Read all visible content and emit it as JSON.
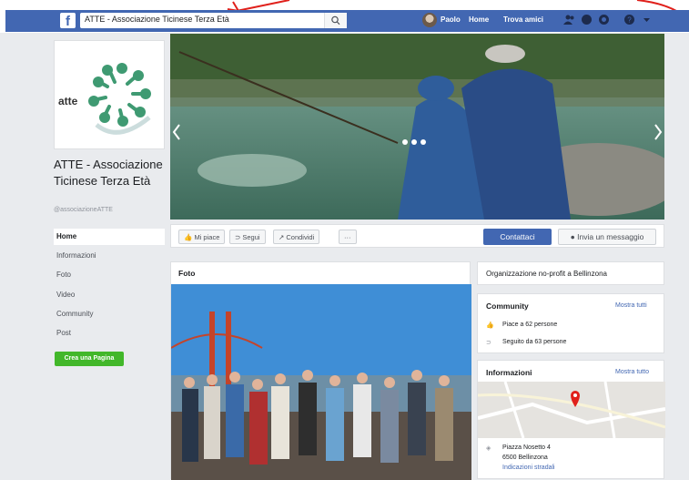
{
  "topbar": {
    "search_value": "ATTE - Associazione Ticinese Terza Età",
    "user_name": "Paolo",
    "nav_home": "Home",
    "nav_find_friends": "Trova amici"
  },
  "page": {
    "logo_text": "atte",
    "logo_ring_text": "associazione ticinese terza età",
    "name": "ATTE - Associazione Ticinese Terza Età",
    "handle": "@associazioneATTE"
  },
  "sidebar": {
    "items": [
      {
        "label": "Home"
      },
      {
        "label": "Informazioni"
      },
      {
        "label": "Foto"
      },
      {
        "label": "Video"
      },
      {
        "label": "Community"
      },
      {
        "label": "Post"
      }
    ],
    "create_page": "Crea una Pagina"
  },
  "actions": {
    "like": "Mi piace",
    "follow": "Segui",
    "share": "Condividi",
    "more": "···",
    "contact": "Contattaci",
    "message": "Invia un messaggio"
  },
  "photos": {
    "title": "Foto"
  },
  "category": "Organizzazione no-profit a Bellinzona",
  "community": {
    "title": "Community",
    "see_all": "Mostra tutti",
    "likes": "Piace a 62 persone",
    "followers": "Seguito da 63 persone"
  },
  "info": {
    "title": "Informazioni",
    "see_all": "Mostra tutto",
    "address_line1": "Piazza Nosetto 4",
    "address_line2": "6500 Bellinzona",
    "directions": "Indicazioni stradali"
  },
  "colors": {
    "fb_blue": "#4267b2",
    "green": "#42b72a",
    "annotation_red": "#e0201b"
  }
}
